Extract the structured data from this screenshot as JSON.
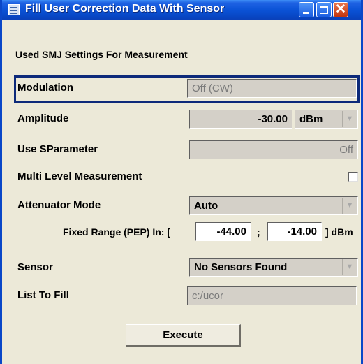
{
  "window": {
    "title": "Fill User Correction Data With Sensor",
    "icon": "window-menu-icon",
    "controls": [
      "minimize-icon",
      "maximize-icon",
      "close-icon"
    ],
    "close_glyph": "✕"
  },
  "section_title": "Used SMJ Settings For Measurement",
  "modulation": {
    "label": "Modulation",
    "value": "Off (CW)"
  },
  "amplitude": {
    "label": "Amplitude",
    "value": "-30.00",
    "unit": "dBm"
  },
  "use_sparameter": {
    "label": "Use SParameter",
    "value": "Off"
  },
  "multi_level": {
    "label": "Multi Level Measurement",
    "checked": false
  },
  "attenuator_mode": {
    "label": "Attenuator Mode",
    "value": "Auto"
  },
  "fixed_range": {
    "label": "Fixed Range (PEP) In: [",
    "min": "-44.00",
    "separator": ";",
    "max": "-14.00",
    "suffix": "] dBm"
  },
  "sensor": {
    "label": "Sensor",
    "value": "No Sensors Found"
  },
  "list_to_fill": {
    "label": "List To Fill",
    "value": "c:/ucor"
  },
  "execute_label": "Execute",
  "dropdown_glyph": "▼"
}
